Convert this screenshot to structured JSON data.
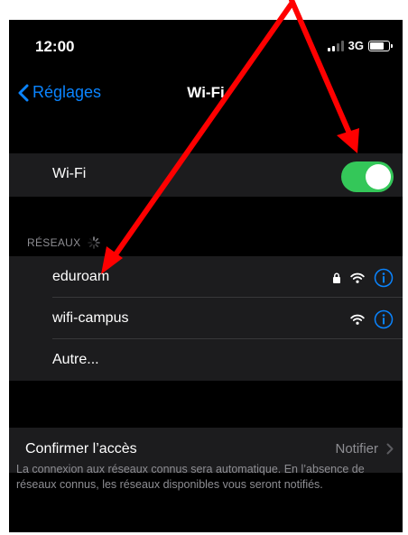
{
  "status_bar": {
    "time": "12:00",
    "network": "3G"
  },
  "nav": {
    "back_label": "Réglages",
    "title": "Wi-Fi"
  },
  "wifi": {
    "label": "Wi-Fi",
    "enabled": true
  },
  "networks": {
    "header": "RÉSEAUX",
    "items": [
      {
        "name": "eduroam",
        "secured": true
      },
      {
        "name": "wifi-campus",
        "secured": false
      }
    ],
    "other_label": "Autre..."
  },
  "confirm": {
    "label": "Confirmer l’accès",
    "value": "Notifier"
  },
  "footer": {
    "text": "La connexion aux réseaux connus sera automatique. En l’absence de réseaux connus, les réseaux disponibles vous seront notifiés."
  },
  "colors": {
    "accent": "#0a84ff",
    "toggle_on": "#34c759",
    "annotation": "#ff0000",
    "cell_bg": "#1c1c1e"
  }
}
